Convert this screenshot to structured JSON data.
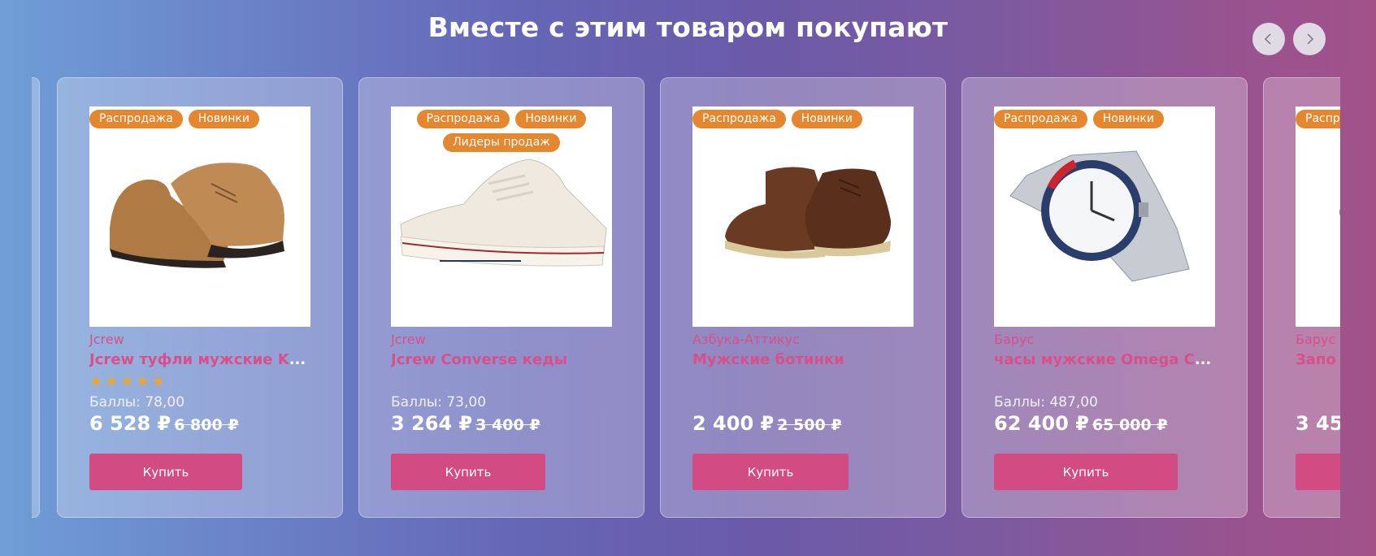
{
  "section_title": "Вместе с этим товаром покупают",
  "nav": {
    "prev_icon": "chevron-left-icon",
    "next_icon": "chevron-right-icon"
  },
  "cards": [
    {
      "badges": [
        "Распродажа",
        "Новинки"
      ],
      "brand": "Jcrew",
      "name": "Jcrew туфли мужские K",
      "ellipsis": "...",
      "rating": 5,
      "points": "Баллы: 78,00",
      "price": "6 528 ₽",
      "old_price": "6 800 ₽",
      "buy_label": "Купить",
      "image": "brown-suede-chukka-shoes"
    },
    {
      "badges": [
        "Распродажа",
        "Новинки",
        "Лидеры продаж"
      ],
      "brand": "Jcrew",
      "name": "Jcrew Converse кеды",
      "ellipsis": "",
      "rating": 0,
      "points": "Баллы: 73,00",
      "price": "3 264 ₽",
      "old_price": "3 400 ₽",
      "buy_label": "Купить",
      "image": "white-canvas-sneaker"
    },
    {
      "badges": [
        "Распродажа",
        "Новинки"
      ],
      "brand": "Азбука-Аттикус",
      "name": "Мужские ботинки",
      "ellipsis": "",
      "rating": 0,
      "points": "",
      "price": "2 400 ₽",
      "old_price": "2 500 ₽",
      "buy_label": "Купить",
      "image": "brown-leather-boots"
    },
    {
      "badges": [
        "Распродажа",
        "Новинки"
      ],
      "brand": "Барус",
      "name": "часы мужские Omega C",
      "ellipsis": "...",
      "rating": 0,
      "points": "Баллы: 487,00",
      "price": "62 400 ₽",
      "old_price": "65 000 ₽",
      "buy_label": "Купить",
      "image": "steel-wrist-watch"
    },
    {
      "badges": [
        "Распрод"
      ],
      "brand": "Барус",
      "name": "Запо",
      "ellipsis": "",
      "rating": 0,
      "points": "",
      "price": "3 45",
      "old_price": "",
      "buy_label": "",
      "image": "partial-product"
    }
  ],
  "colors": {
    "accent": "#d24b83",
    "badge": "#e4872f",
    "brand_text": "#d94f8c"
  }
}
